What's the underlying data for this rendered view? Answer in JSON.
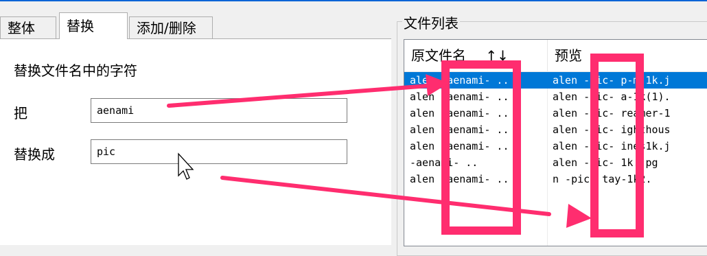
{
  "tabs": [
    {
      "label": "整体",
      "active": false
    },
    {
      "label": "替换",
      "active": true
    },
    {
      "label": "添加/删除",
      "active": false
    }
  ],
  "replace_panel": {
    "heading": "替换文件名中的字符",
    "find_label": "把",
    "find_value": "aenami",
    "replace_label": "替换成",
    "replace_value": "pic"
  },
  "file_list": {
    "group_title": "文件列表",
    "col_original": "原文件名",
    "sort_indicator": "↑↓",
    "col_preview": "预览",
    "rows": [
      {
        "original": "alen -aenami- ..",
        "preview": "alen -pic- p-m-1k.j",
        "selected": true
      },
      {
        "original": "alen -aenami- ..",
        "preview": "alen -pic- a-1k(1).",
        "selected": false
      },
      {
        "original": "alen -aenami- ..",
        "preview": "alen -pic- reamer-1",
        "selected": false
      },
      {
        "original": "alen -aenami- ..",
        "preview": "alen -pic- ighthous",
        "selected": false
      },
      {
        "original": "alen -aenami- ..",
        "preview": "alen -pic- ines1k.j",
        "selected": false
      },
      {
        "original": "     -aenami- ..",
        "preview": "alen -pic- 1k.jpg",
        "selected": false
      },
      {
        "original": "alen -aenami- ..",
        "preview": "  n -pic- tay-1k2.",
        "selected": false
      }
    ]
  },
  "colors": {
    "accent": "#0078d7",
    "annotation": "#ff2d6f"
  }
}
